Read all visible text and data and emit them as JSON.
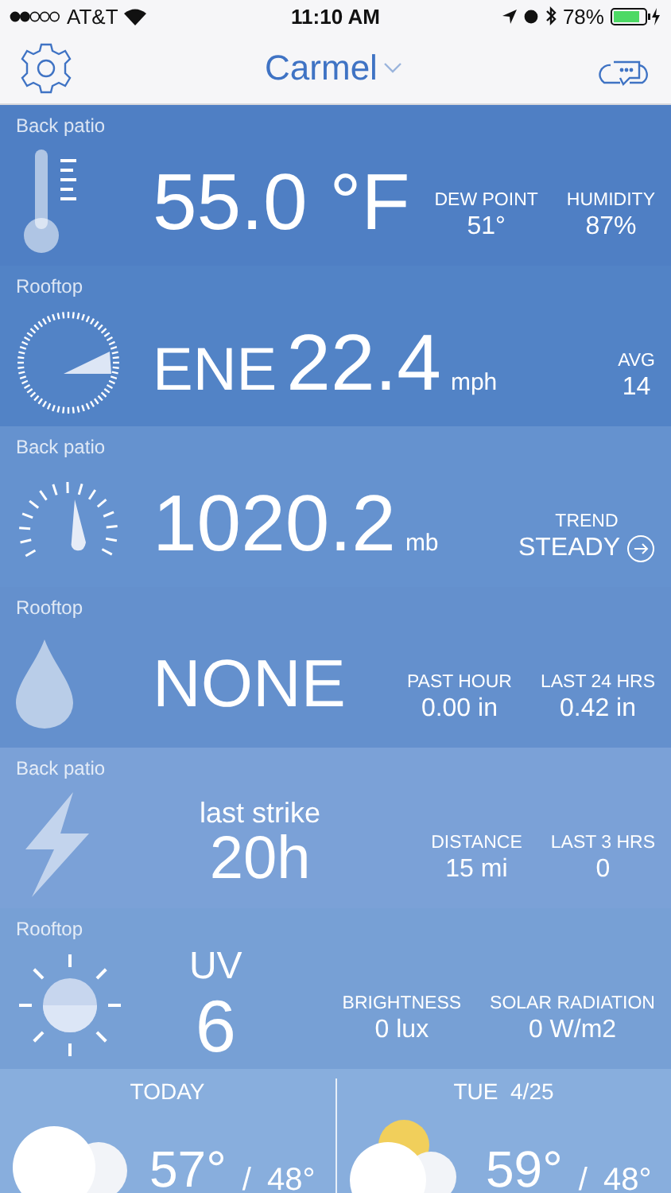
{
  "status_bar": {
    "carrier": "AT&T",
    "time": "11:10 AM",
    "battery": "78%"
  },
  "header": {
    "location": "Carmel"
  },
  "cards": [
    {
      "kind": "temperature",
      "station": "Back patio",
      "value": "55.0 °F",
      "stats": [
        {
          "label": "DEW POINT",
          "value": "51°"
        },
        {
          "label": "HUMIDITY",
          "value": "87%"
        }
      ]
    },
    {
      "kind": "wind",
      "station": "Rooftop",
      "direction": "ENE",
      "value": "22.4",
      "unit": "mph",
      "stats": [
        {
          "label": "AVG",
          "value": "14"
        }
      ]
    },
    {
      "kind": "pressure",
      "station": "Back patio",
      "value": "1020.2",
      "unit": "mb",
      "stats": [
        {
          "label": "TREND",
          "value": "STEADY"
        }
      ]
    },
    {
      "kind": "rain",
      "station": "Rooftop",
      "value": "NONE",
      "stats": [
        {
          "label": "PAST HOUR",
          "value": "0.00 in"
        },
        {
          "label": "LAST 24 HRS",
          "value": "0.42 in"
        }
      ]
    },
    {
      "kind": "lightning",
      "station": "Back patio",
      "caption": "last strike",
      "value": "20h",
      "stats": [
        {
          "label": "DISTANCE",
          "value": "15 mi"
        },
        {
          "label": "LAST 3 HRS",
          "value": "0"
        }
      ]
    },
    {
      "kind": "solar",
      "station": "Rooftop",
      "caption": "UV",
      "value": "6",
      "stats": [
        {
          "label": "BRIGHTNESS",
          "value": "0 lux"
        },
        {
          "label": "SOLAR RADIATION",
          "value": "0 W/m2"
        }
      ]
    }
  ],
  "forecast": [
    {
      "day": "TODAY",
      "kind": "cloudy",
      "high": "57°",
      "separator": "/",
      "low": "48°"
    },
    {
      "day": "TUE  4/25",
      "kind": "partly-cloudy",
      "high": "59°",
      "separator": "/",
      "low": "48°"
    }
  ]
}
